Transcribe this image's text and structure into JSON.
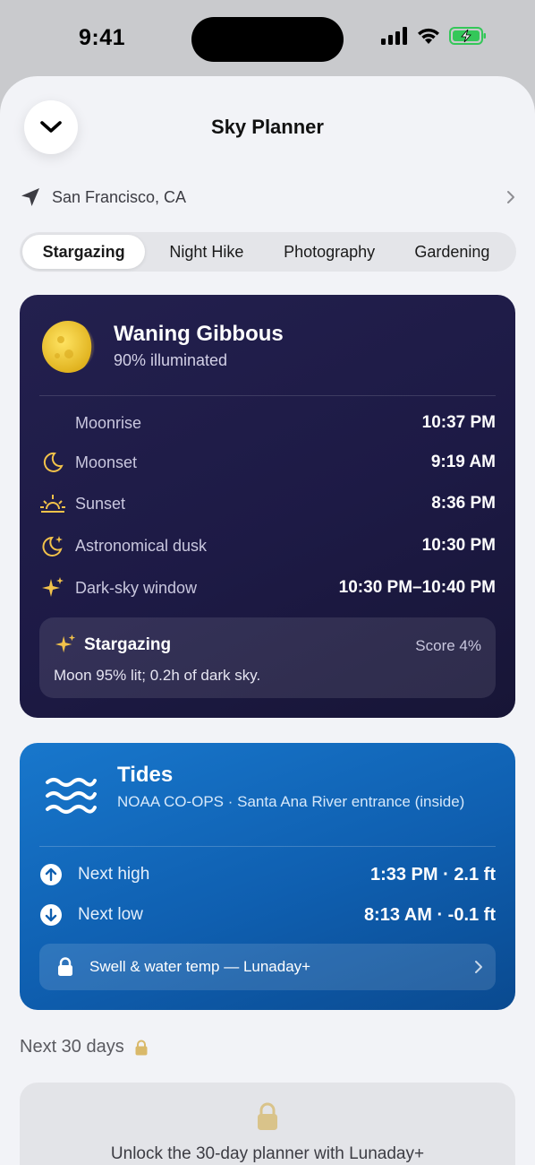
{
  "status_bar": {
    "time": "9:41",
    "icons": [
      "signal-icon",
      "wifi-icon",
      "battery-charging-icon"
    ],
    "battery_color": "#34c759"
  },
  "header": {
    "title": "Sky Planner",
    "close_icon": "chevron-down-icon"
  },
  "location": {
    "label": "San Francisco, CA",
    "icon": "location-arrow-icon"
  },
  "segments": {
    "items": [
      "Stargazing",
      "Night Hike",
      "Photography",
      "Gardening"
    ],
    "selected": "Stargazing"
  },
  "moon": {
    "phase": "Waning Gibbous",
    "illumination": "90% illuminated",
    "events": [
      {
        "label": "Moonrise",
        "value": "10:37 PM",
        "icon": ""
      },
      {
        "label": "Moonset",
        "value": "9:19 AM",
        "icon": "crescent-moon-icon"
      },
      {
        "label": "Sunset",
        "value": "8:36 PM",
        "icon": "sunset-icon"
      },
      {
        "label": "Astronomical dusk",
        "value": "10:30 PM",
        "icon": "moon-stars-icon"
      },
      {
        "label": "Dark-sky window",
        "value": "10:30 PM–10:40 PM",
        "icon": "sparkles-icon"
      }
    ],
    "activity": {
      "title": "Stargazing",
      "score": "Score 4%",
      "description": "Moon 95% lit; 0.2h of dark sky."
    },
    "accent_color": "#f2c24a"
  },
  "tides": {
    "title": "Tides",
    "source": "NOAA CO-OPS · Santa Ana River entrance (inside)",
    "rows": [
      {
        "label": "Next high",
        "value": "1:33 PM · 2.1 ft",
        "icon": "arrow-up-circle-icon"
      },
      {
        "label": "Next low",
        "value": "8:13 AM · -0.1 ft",
        "icon": "arrow-down-circle-icon"
      }
    ],
    "upsell": "Swell & water temp — Lunaday+"
  },
  "next30": {
    "title": "Next 30 days",
    "unlock_text": "Unlock the 30-day planner with Lunaday+",
    "lock_color": "#d9b96a"
  }
}
